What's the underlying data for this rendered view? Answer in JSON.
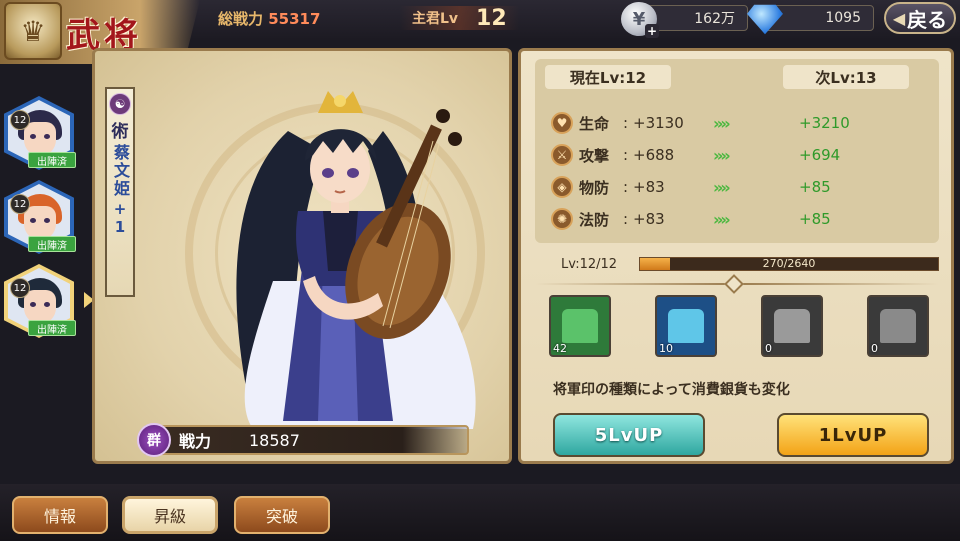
{
  "header": {
    "title": "武将",
    "total_power_label": "総戦力",
    "total_power_value": "55317",
    "lord_level_label": "主君Lv",
    "lord_level_value": "12",
    "silver": "162万",
    "gems": "1095",
    "back_label": "戻る"
  },
  "characters": [
    {
      "level": "12",
      "status": "出陣済",
      "hair": "#2c2a4a",
      "hair_accent": "#3b6fc2"
    },
    {
      "level": "12",
      "status": "出陣済",
      "hair": "#d9642a",
      "hair_accent": "#f0a040"
    },
    {
      "level": "12",
      "status": "出陣済",
      "hair": "#1f2a3a",
      "hair_accent": "#5a4a7a",
      "selected": true
    }
  ],
  "hero": {
    "class_label": "術",
    "name": "蔡文姫",
    "plus": "+1",
    "faction_icon": "群",
    "power_label": "戦力",
    "power_value": "18587"
  },
  "stats": {
    "current_level_label": "現在Lv:12",
    "next_level_label": "次Lv:13",
    "rows": [
      {
        "icon": "heart-icon",
        "glyph": "♥",
        "name": "生命",
        "current": "+3130",
        "next": "+3210"
      },
      {
        "icon": "attack-icon",
        "glyph": "⚔",
        "name": "攻撃",
        "current": "+688",
        "next": "+694"
      },
      {
        "icon": "shield-icon",
        "glyph": "◈",
        "name": "物防",
        "current": "+83",
        "next": "+85"
      },
      {
        "icon": "magic-shield-icon",
        "glyph": "✺",
        "name": "法防",
        "current": "+83",
        "next": "+85"
      }
    ],
    "arrow": "»»"
  },
  "level_progress": {
    "label": "Lv:12/12",
    "text": "270/2640",
    "fraction": 0.102
  },
  "seals": [
    {
      "name": "jade-seal-icon",
      "count": "42",
      "bg": "#2e7a3a",
      "seal": "#5bc26a"
    },
    {
      "name": "blue-turtle-seal-icon",
      "count": "10",
      "bg": "#1d4f86",
      "seal": "#5fc6e8"
    },
    {
      "name": "dragon-seal-icon",
      "count": "0",
      "bg": "#3a3a3a",
      "seal": "#9a9a9a"
    },
    {
      "name": "lion-seal-icon",
      "count": "0",
      "bg": "#3a3a3a",
      "seal": "#8a8a8a"
    }
  ],
  "hint": "将軍印の種類によって消費銀貨も変化",
  "buttons": {
    "lvup5": "5LvUP",
    "lvup1": "1LvUP"
  },
  "tabs": [
    {
      "label": "情報"
    },
    {
      "label": "昇級",
      "active": true
    },
    {
      "label": "突破"
    }
  ]
}
